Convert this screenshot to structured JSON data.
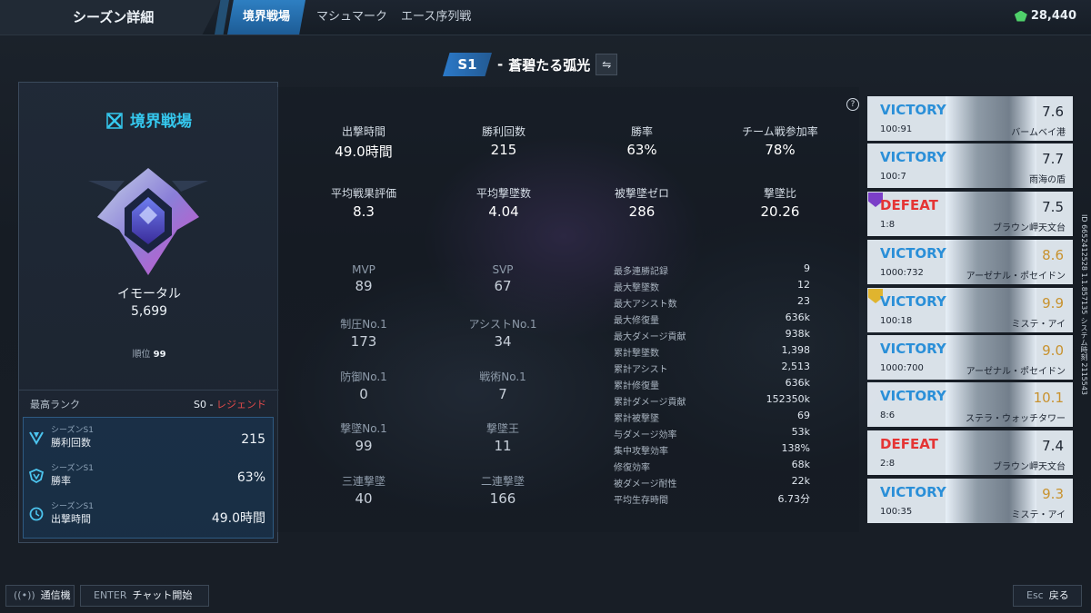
{
  "header": {
    "page_title": "シーズン詳細",
    "tabs": [
      {
        "label": "境界戦場",
        "active": true
      },
      {
        "label": "マシュマーク",
        "active": false
      },
      {
        "label": "エース序列戦",
        "active": false
      }
    ],
    "currency": "28,440",
    "currency_icon": "gem-icon"
  },
  "season": {
    "tag": "S1",
    "separator": "-",
    "name": "蒼碧たる弧光",
    "swap_icon": "⇋"
  },
  "left_panel": {
    "mode_title": "境界戦場",
    "rank_name": "イモータル",
    "rank_points": "5,699",
    "rank_order_label": "順位",
    "rank_order_value": "99",
    "best_rank_label": "最高ランク",
    "best_rank_season": "S0",
    "best_rank_sep": "-",
    "best_rank_name": "レジェンド",
    "stats": [
      {
        "sub": "シーズンS1",
        "label": "勝利回数",
        "value": "215",
        "icon": "victory-icon"
      },
      {
        "sub": "シーズンS1",
        "label": "勝率",
        "value": "63%",
        "icon": "winrate-icon"
      },
      {
        "sub": "シーズンS1",
        "label": "出撃時間",
        "value": "49.0時間",
        "icon": "clock-icon"
      }
    ]
  },
  "main_stats": [
    {
      "label": "出撃時間",
      "value": "49.0時間"
    },
    {
      "label": "勝利回数",
      "value": "215"
    },
    {
      "label": "勝率",
      "value": "63%"
    },
    {
      "label": "チーム戦参加率",
      "value": "78%"
    },
    {
      "label": "平均戦果評価",
      "value": "8.3"
    },
    {
      "label": "平均撃墜数",
      "value": "4.04"
    },
    {
      "label": "被撃墜ゼロ",
      "value": "286"
    },
    {
      "label": "撃墜比",
      "value": "20.26"
    }
  ],
  "award_stats": [
    {
      "label": "MVP",
      "value": "89"
    },
    {
      "label": "SVP",
      "value": "67"
    },
    {
      "label": "制圧No.1",
      "value": "173"
    },
    {
      "label": "アシストNo.1",
      "value": "34"
    },
    {
      "label": "防御No.1",
      "value": "0"
    },
    {
      "label": "戦術No.1",
      "value": "7"
    },
    {
      "label": "撃墜No.1",
      "value": "99"
    },
    {
      "label": "撃墜王",
      "value": "11"
    },
    {
      "label": "三連撃墜",
      "value": "40"
    },
    {
      "label": "二連撃墜",
      "value": "166"
    }
  ],
  "details": [
    {
      "label": "最多連勝記録",
      "value": "9"
    },
    {
      "label": "最大撃墜数",
      "value": "12"
    },
    {
      "label": "最大アシスト数",
      "value": "23"
    },
    {
      "label": "最大修復量",
      "value": "636k"
    },
    {
      "label": "最大ダメージ貢献",
      "value": "938k"
    },
    {
      "label": "累計撃墜数",
      "value": "1,398"
    },
    {
      "label": "累計アシスト",
      "value": "2,513"
    },
    {
      "label": "累計修復量",
      "value": "636k"
    },
    {
      "label": "累計ダメージ貢献",
      "value": "152350k"
    },
    {
      "label": "累計被撃墜",
      "value": "69"
    },
    {
      "label": "与ダメージ効率",
      "value": "53k"
    },
    {
      "label": "集中攻撃効率",
      "value": "138%"
    },
    {
      "label": "修復効率",
      "value": "68k"
    },
    {
      "label": "被ダメージ耐性",
      "value": "22k"
    },
    {
      "label": "平均生存時間",
      "value": "6.73分"
    }
  ],
  "help_icon": "?",
  "matches": [
    {
      "result": "VICTORY",
      "score": "100:91",
      "rating": "7.6",
      "map": "バームベイ港",
      "badge": ""
    },
    {
      "result": "VICTORY",
      "score": "100:7",
      "rating": "7.7",
      "map": "雨海の盾",
      "badge": ""
    },
    {
      "result": "DEFEAT",
      "score": "1:8",
      "rating": "7.5",
      "map": "ブラウン岬天文台",
      "badge": "svp"
    },
    {
      "result": "VICTORY",
      "score": "1000:732",
      "rating": "8.6",
      "map": "アーゼナル・ポセイドン",
      "badge": ""
    },
    {
      "result": "VICTORY",
      "score": "100:18",
      "rating": "9.9",
      "map": "ミステ・アイ",
      "badge": "mvp"
    },
    {
      "result": "VICTORY",
      "score": "1000:700",
      "rating": "9.0",
      "map": "アーゼナル・ポセイドン",
      "badge": ""
    },
    {
      "result": "VICTORY",
      "score": "8:6",
      "rating": "10.1",
      "map": "ステラ・ウォッチタワー",
      "badge": ""
    },
    {
      "result": "DEFEAT",
      "score": "2:8",
      "rating": "7.4",
      "map": "ブラウン岬天文台",
      "badge": ""
    },
    {
      "result": "VICTORY",
      "score": "100:35",
      "rating": "9.3",
      "map": "ミステ・アイ",
      "badge": ""
    }
  ],
  "side_id": "ID 6652412528  1.1.857135  システム時刻  2115543",
  "bottom": {
    "comm_label": "通信機",
    "chat_key": "ENTER",
    "chat_label": "チャット開始",
    "back_key": "Esc",
    "back_label": "戻る"
  },
  "colors": {
    "accent": "#2b79c8",
    "victory": "#2a8fd8",
    "defeat": "#e53535",
    "rating_gold": "#e0a63a",
    "mode_title": "#35c8ee"
  }
}
